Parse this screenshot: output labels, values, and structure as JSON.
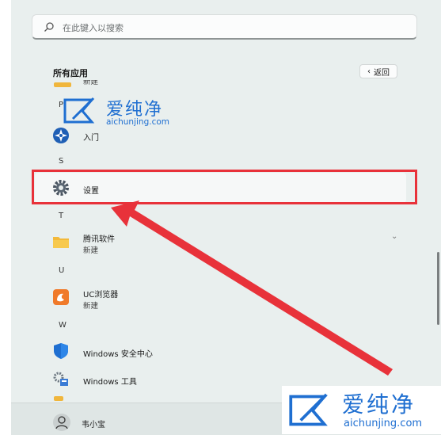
{
  "search": {
    "placeholder": "在此键入以搜索"
  },
  "header": {
    "title": "所有应用",
    "back_label": "返回"
  },
  "letters": {
    "s": "S",
    "t": "T",
    "u": "U",
    "w": "W"
  },
  "apps": {
    "partial_top": "新建",
    "rumen": {
      "name": "入门"
    },
    "settings": {
      "name": "设置"
    },
    "tencent": {
      "name": "腾讯软件",
      "sub": "新建"
    },
    "uc": {
      "name": "UC浏览器",
      "sub": "新建"
    },
    "defender": {
      "name": "Windows 安全中心"
    },
    "tools": {
      "name": "Windows 工具"
    }
  },
  "user": {
    "name": "韦小宝"
  },
  "watermark": {
    "brand": "爱纯净",
    "url": "aichunjing.com"
  },
  "colors": {
    "highlight_border": "#e8323a",
    "accent": "#1f6fd1"
  }
}
